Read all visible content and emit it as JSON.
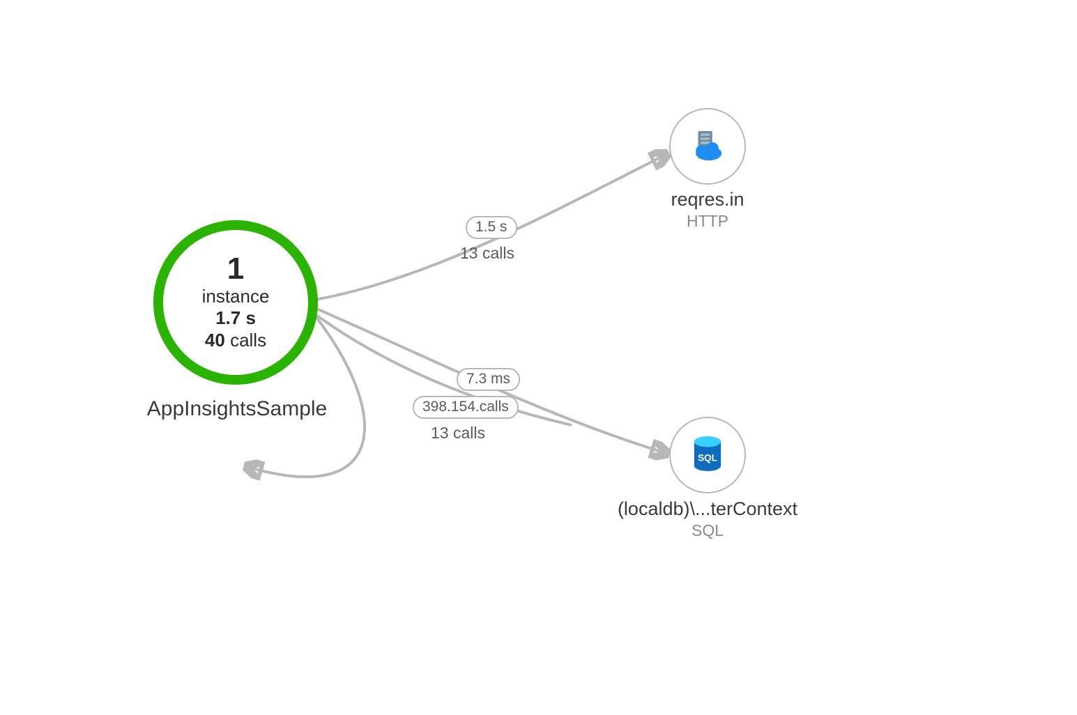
{
  "app_node": {
    "instance_count": "1",
    "instance_word": "instance",
    "latency_value": "1.7",
    "latency_unit": "s",
    "calls_value": "40",
    "calls_word": "calls",
    "name": "AppInsightsSample"
  },
  "dependencies": [
    {
      "name": "reqres.in",
      "type": "HTTP",
      "icon": "cloud-server-icon"
    },
    {
      "name": "(localdb)\\...terContext",
      "type": "SQL",
      "icon": "sql-database-icon"
    }
  ],
  "edges": {
    "to_http": {
      "latency": "1.5 s",
      "calls": "13 calls"
    },
    "to_sql": {
      "latency": "7.3 ms",
      "calls_overlap": "398.154.calls"
    },
    "self_loop": {
      "latency_overlap": "398.154.calls",
      "calls": "13 calls"
    }
  }
}
